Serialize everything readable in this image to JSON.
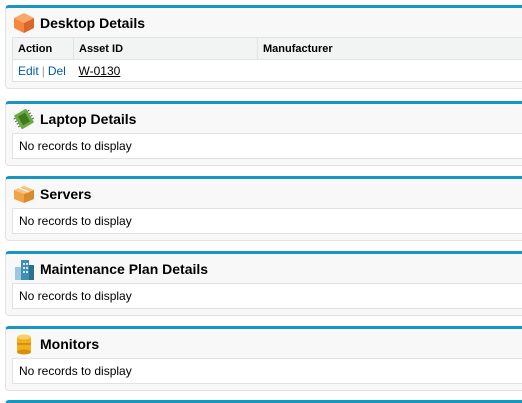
{
  "sections": {
    "desktop": {
      "title": "Desktop Details",
      "columns": [
        "Action",
        "Asset ID",
        "Manufacturer"
      ],
      "rows": [
        {
          "edit": "Edit",
          "separator": "|",
          "del": "Del",
          "asset_id": "W-0130",
          "manufacturer": ""
        }
      ],
      "icon": "desktop-box-icon",
      "icon_color": "#f5853f"
    },
    "laptop": {
      "title": "Laptop Details",
      "empty_message": "No records to display",
      "icon": "laptop-chip-icon",
      "icon_color": "#6aab42"
    },
    "servers": {
      "title": "Servers",
      "empty_message": "No records to display",
      "icon": "servers-box-icon",
      "icon_color": "#f0a347"
    },
    "maintenance": {
      "title": "Maintenance Plan Details",
      "empty_message": "No records to display",
      "icon": "building-icon",
      "icon_color": "#3f8fb5"
    },
    "monitors": {
      "title": "Monitors",
      "empty_message": "No records to display",
      "icon": "cylinder-icon",
      "icon_color": "#f2b01e"
    }
  },
  "colors": {
    "accent": "#1797c0",
    "link": "#015ba7"
  }
}
